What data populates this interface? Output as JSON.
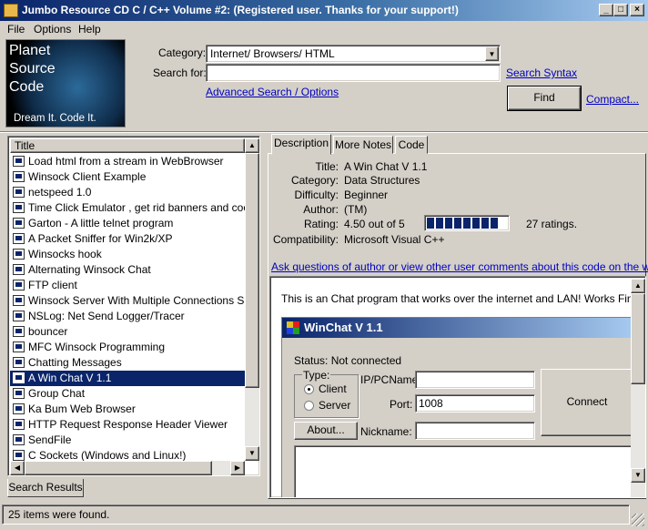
{
  "window": {
    "title": "Jumbo Resource CD C / C++ Volume #2: (Registered user.  Thanks for your support!)",
    "min_label": "_",
    "max_label": "□",
    "close_label": "×"
  },
  "menu": [
    "File",
    "Options",
    "Help"
  ],
  "logo": {
    "line1": "Planet",
    "line2": "Source",
    "line3": "Code",
    "tagline": "Dream It.  Code It."
  },
  "search": {
    "category_label": "Category:",
    "category_value": "Internet/ Browsers/ HTML",
    "search_label": "Search for:",
    "search_value": "",
    "syntax_link": "Search Syntax",
    "advanced_link": "Advanced Search / Options",
    "find_label": "Find",
    "compact_link": "Compact..."
  },
  "list": {
    "header": "Title",
    "items": [
      "Load html from a stream in WebBrowser",
      "Winsock Client Example",
      "netspeed 1.0",
      "Time Click Emulator , get rid banners and cookies!",
      "Garton - A little telnet program",
      "A Packet Sniffer for Win2k/XP",
      "Winsocks hook",
      "Alternating Winsock Chat",
      "FTP client",
      "Winsock Server With Multiple Connections Support",
      "NSLog: Net Send Logger/Tracer",
      "bouncer",
      "MFC Winsock Programming",
      "Chatting Messages",
      "A Win Chat V 1.1",
      "Group Chat",
      "Ka Bum Web Browser",
      "HTTP Request Response Header Viewer",
      "SendFile",
      "C Sockets (Windows and Linux!)"
    ],
    "selected_index": 14,
    "tab_label": "Search Results"
  },
  "detail": {
    "tabs": [
      "Description",
      "More Notes",
      "Code"
    ],
    "title_label": "Title:",
    "title_value": "A Win Chat V 1.1",
    "category_label": "Category:",
    "category_value": "Data Structures",
    "difficulty_label": "Difficulty:",
    "difficulty_value": "Beginner",
    "author_label": "Author:",
    "author_value": "(TM)",
    "rating_label": "Rating:",
    "rating_value": "4.50 out of 5",
    "rating_fraction": 0.9,
    "ratings_count": "27 ratings.",
    "compat_label": "Compatibility:",
    "compat_value": "Microsoft Visual C++",
    "ask_link": "Ask questions of author or view other user comments about this code on the web..."
  },
  "content": {
    "description": "This is an Chat program that works over the internet and LAN! Works Fine!",
    "winchat": {
      "title": "WinChat V 1.1",
      "status": "Status: Not connected",
      "type_label": "Type:",
      "client_label": "Client",
      "server_label": "Server",
      "ip_label": "IP/PCName:",
      "ip_value": "",
      "port_label": "Port:",
      "port_value": "1008",
      "connect_label": "Connect",
      "about_label": "About...",
      "nickname_label": "Nickname:",
      "nickname_value": ""
    }
  },
  "status": {
    "text": "25 items were found."
  }
}
